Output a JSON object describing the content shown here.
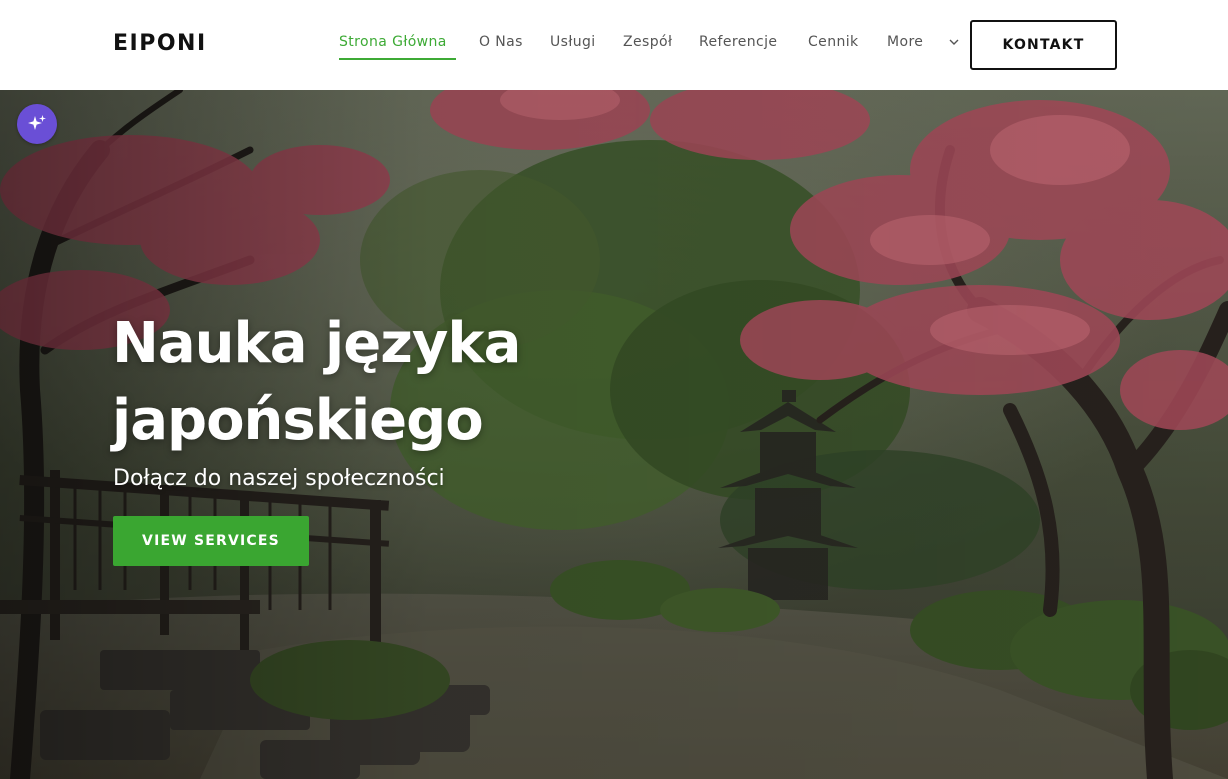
{
  "header": {
    "logo": "EIPONI",
    "nav": [
      {
        "label": "Strona Główna",
        "active": true
      },
      {
        "label": "O Nas"
      },
      {
        "label": "Usługi"
      },
      {
        "label": "Zespół"
      },
      {
        "label": "Referencje"
      },
      {
        "label": "Cennik"
      },
      {
        "label": "More"
      }
    ],
    "contact_label": "KONTAKT"
  },
  "hero": {
    "title": "Nauka języka japońskiego",
    "subtitle": "Dołącz do naszej społeczności",
    "cta_label": "VIEW SERVICES"
  },
  "colors": {
    "accent_green": "#3aa631",
    "magic_purple": "#6a4fd6",
    "text_dark": "#111111",
    "nav_text": "#555555"
  },
  "icons": {
    "more_dropdown": "chevron-down-icon",
    "magic": "sparkles-icon"
  }
}
